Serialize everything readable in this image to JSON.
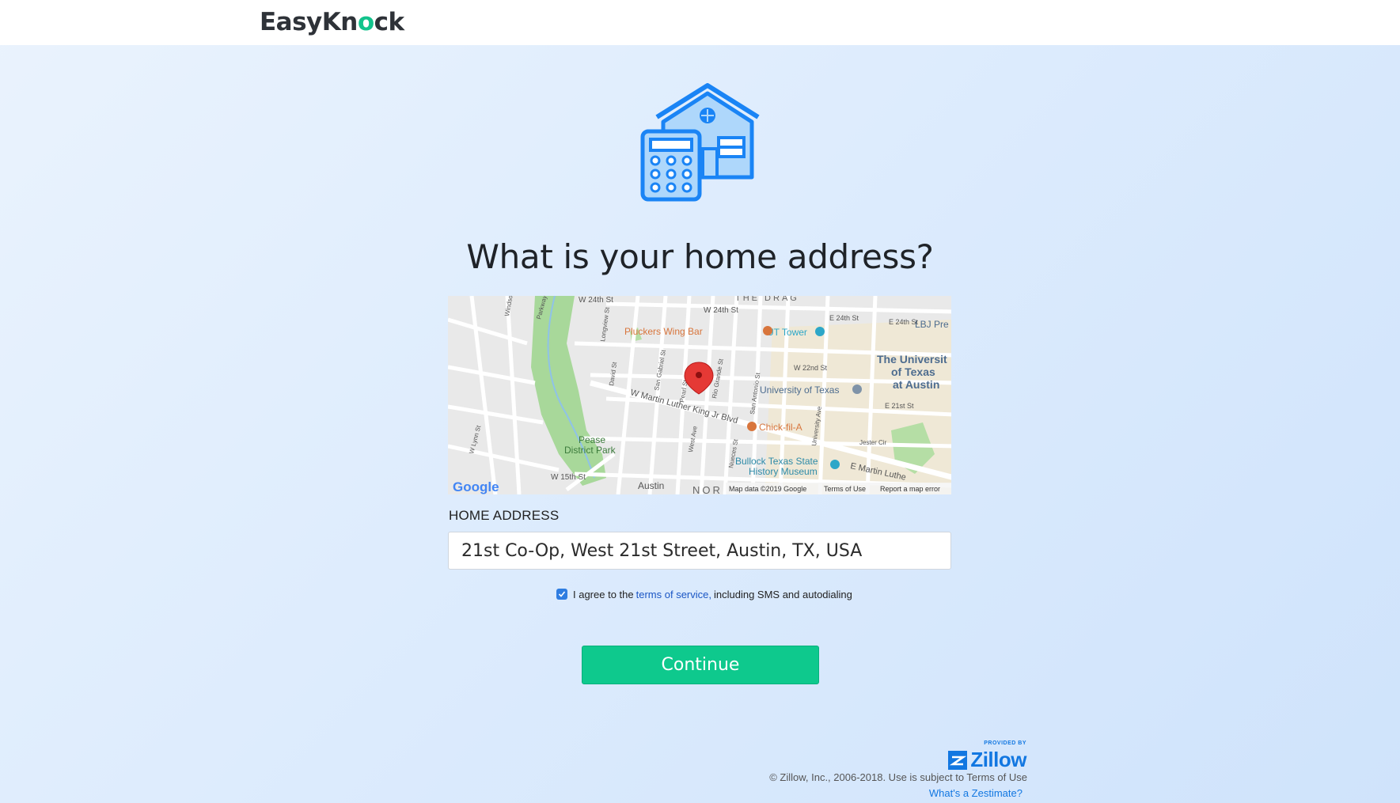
{
  "brand": {
    "logo_before": "EasyKn",
    "logo_o": "o",
    "logo_after": "ck",
    "accent_color": "#12c38c"
  },
  "hero": {
    "icon": "house-calculator-icon"
  },
  "title": "What is your home address?",
  "map": {
    "labels": {
      "w24th_top": "W 24th St",
      "the_drag": "THE DRAG",
      "w24th": "W 24th St",
      "e24th": "E 24th St",
      "e24th_b": "E 24th St",
      "lbj": "LBJ Pre",
      "pluckers": "Pluckers Wing Bar",
      "ut_tower": "UT Tower",
      "univ1": "The Universit",
      "univ2": "of Texas",
      "univ3": "at Austin",
      "w22nd": "W 22nd St",
      "uoft": "University of Texas",
      "mlk": "W Martin Luther King Jr Blvd",
      "chick": "Chick-fil-A",
      "pease1": "Pease",
      "pease2": "District Park",
      "bullock1": "Bullock Texas State",
      "bullock2": "History Museum",
      "emlk": "E Martin Luthe",
      "w15th": "W 15th St",
      "austin": "Austin",
      "nor": "NOR",
      "e21st": "E 21st St",
      "jester": "Jester Cir",
      "pearl": "Pearl St",
      "sangab": "San Gabriel St",
      "riogrande": "Rio Grande St",
      "sanant": "San Antonio St",
      "david": "David St",
      "longview": "Longview St",
      "univave": "University Ave",
      "westave": "West Ave",
      "nueces": "Nueces St",
      "parkway": "Parkway",
      "windsor": "Windsor",
      "lynn": "W Lynn St",
      "google": "Google",
      "map_data": "Map data ©2019 Google",
      "terms": "Terms of Use",
      "report": "Report a map error"
    },
    "pin_color": "#e53935"
  },
  "form": {
    "label": "HOME ADDRESS",
    "address_value": "21st Co-Op, West 21st Street, Austin, TX, USA",
    "agree_checked": true,
    "agree_prefix": "I agree to the",
    "agree_link": "terms of service,",
    "agree_suffix": "including SMS and autodialing",
    "continue_label": "Continue",
    "button_color": "#0ec98d"
  },
  "footer": {
    "provided_by": "PROVIDED BY",
    "zillow": "Zillow",
    "copyright": "© Zillow, Inc., 2006-2018. Use is subject to Terms of Use",
    "zestimate_link": "What's a Zestimate?"
  }
}
